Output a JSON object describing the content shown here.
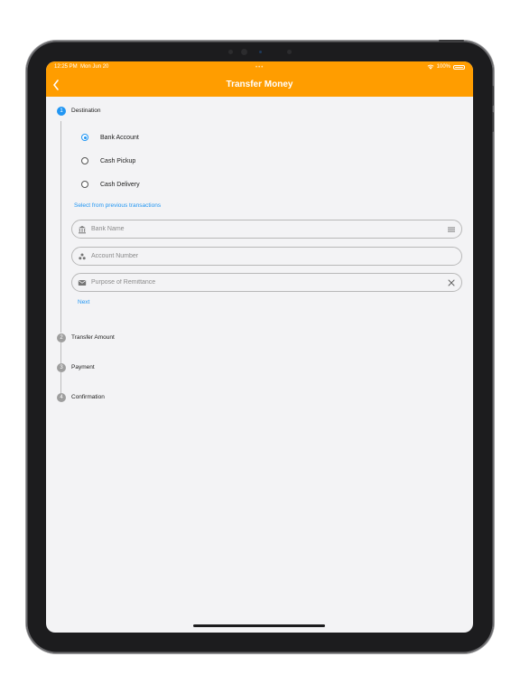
{
  "status_bar": {
    "time": "12:25 PM",
    "date": "Mon Jun 20",
    "battery": "100%"
  },
  "header": {
    "title": "Transfer Money",
    "accent": "#ff9d00"
  },
  "steps": [
    {
      "number": "1",
      "label": "Destination"
    },
    {
      "number": "2",
      "label": "Transfer Amount"
    },
    {
      "number": "3",
      "label": "Payment"
    },
    {
      "number": "4",
      "label": "Confirmation"
    }
  ],
  "destination_options": [
    {
      "label": "Bank Account",
      "selected": true
    },
    {
      "label": "Cash Pickup",
      "selected": false
    },
    {
      "label": "Cash Delivery",
      "selected": false
    }
  ],
  "previous_link": "Select from previous transactions",
  "fields": {
    "bank_name": {
      "placeholder": "Bank Name",
      "value": ""
    },
    "account_number": {
      "placeholder": "Account Number",
      "value": ""
    },
    "purpose": {
      "placeholder": "Purpose of Remittance",
      "value": ""
    }
  },
  "next_label": "Next",
  "colors": {
    "step_active": "#2196f3",
    "step_inactive": "#9e9e9e",
    "link": "#2196f3"
  }
}
